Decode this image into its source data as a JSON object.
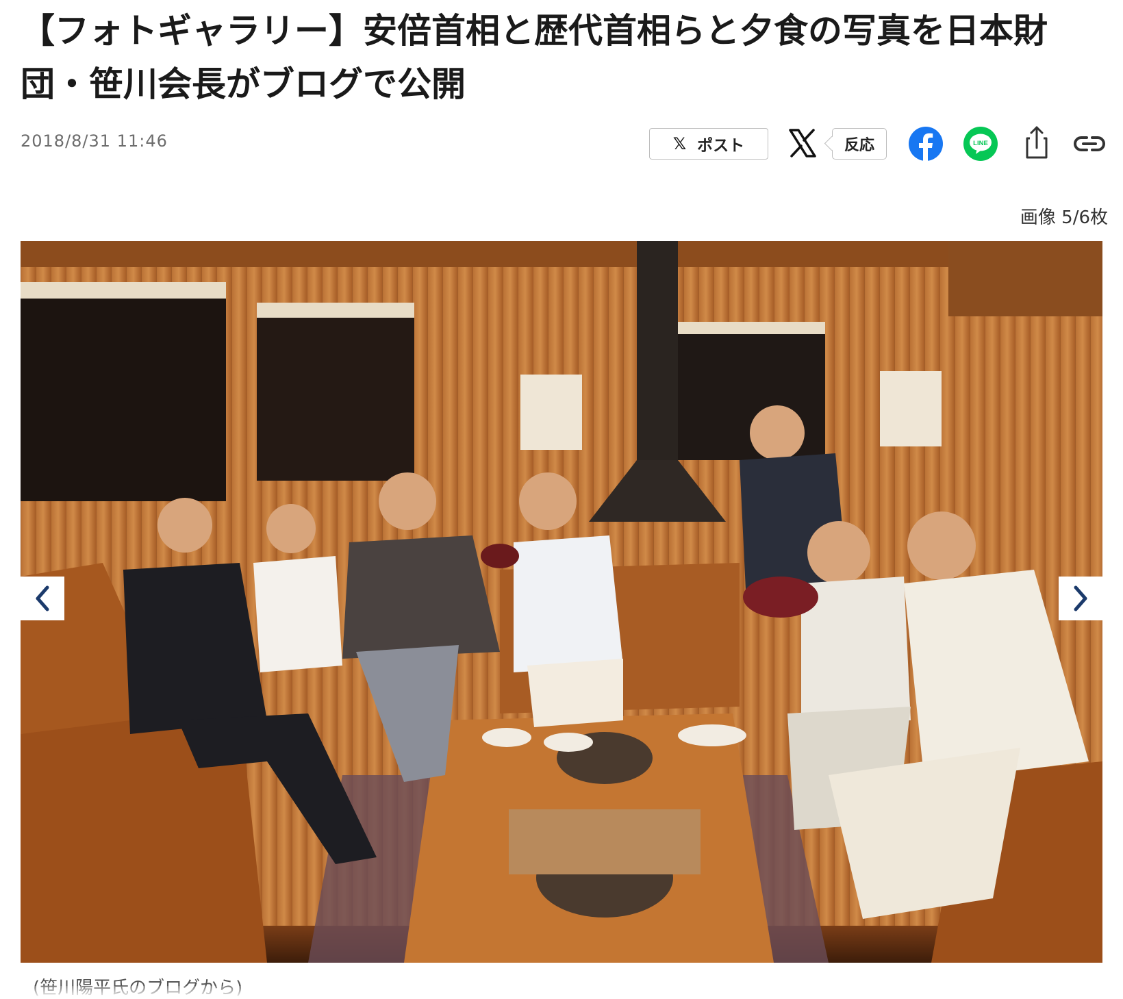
{
  "article": {
    "title": "【フォトギャラリー】安倍首相と歴代首相らと夕食の写真を日本財団・笹川会長がブログで公開",
    "date": "2018/8/31 11:46"
  },
  "share": {
    "post_label": "ポスト",
    "reaction_label": "反応",
    "icons": [
      "x-logo-icon",
      "facebook-icon",
      "line-icon",
      "share-icon",
      "link-icon"
    ],
    "line_text": "LINE",
    "colors": {
      "facebook": "#1877f2",
      "line": "#06c755",
      "x": "#111111"
    }
  },
  "gallery": {
    "counter": "画像 5/6枚",
    "caption": "(笹川陽平氏のブログから)",
    "prev_icon": "chevron-left-icon",
    "next_icon": "chevron-right-icon",
    "nav_color": "#1b3a6b"
  }
}
